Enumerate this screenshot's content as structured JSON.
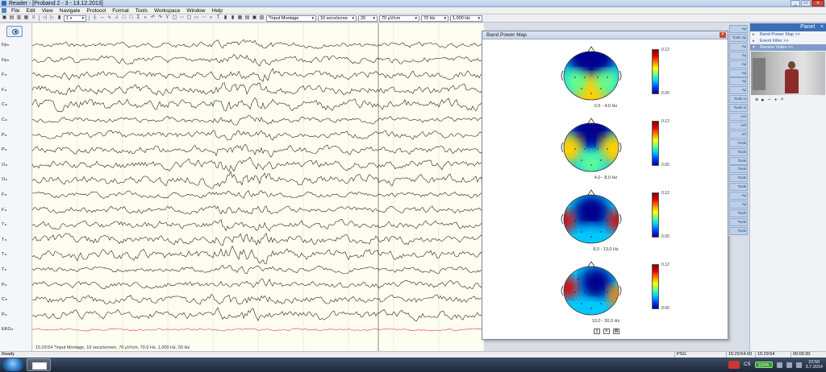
{
  "window": {
    "title": "Reader - [Proband 2 - 3 - 13.12.2013]",
    "controls": [
      "_",
      "▭",
      "x"
    ]
  },
  "menu": [
    "File",
    "Edit",
    "View",
    "Navigate",
    "Protocol",
    "Format",
    "Tools",
    "Workspace",
    "Window",
    "Help"
  ],
  "toolbar": {
    "gain": "1 x",
    "montage": "*Input Montage",
    "timebase": "10 secs/scree",
    "sensitivity_steps": "20",
    "sensitivity": "70 µV/cm",
    "low_filter": "70 Hz",
    "high_filter": "1,000 Hz"
  },
  "channels": [
    "Fp",
    "Fp",
    "F",
    "F",
    "C",
    "C",
    "P",
    "P",
    "O",
    "O",
    "F",
    "F",
    "T",
    "T",
    "T",
    "T",
    "P",
    "C",
    "P",
    "EKG"
  ],
  "eeg": {
    "status_line": "15:29:54 *Input Montage, 10 secs/screen, 70 µV/cm, 70.0 Hz, 1,000 Hz, 50 Hz",
    "trace_color": "#111111",
    "ekg_color": "#d23a3a"
  },
  "band_power_map": {
    "title": "Band Power Map",
    "maps": [
      {
        "band": "0,5 - 4,0 Hz",
        "max": "0.12",
        "min": "0.00"
      },
      {
        "band": "4,0 - 8,0 Hz",
        "max": "0.12",
        "min": "0.00"
      },
      {
        "band": "8,0 - 13,0 Hz",
        "max": "0.12",
        "min": "0.00"
      },
      {
        "band": "13,0 - 30,0 Hz",
        "max": "0.12",
        "min": "0.00"
      }
    ]
  },
  "side_strip": [
    "Ap",
    "Tools Ap",
    "Ap",
    "Ap",
    "Ap",
    "Ap",
    "Ap",
    "Ap",
    "Tools O",
    "Tools O",
    "Arti",
    "Arti",
    "Art",
    "Tools",
    "Tools",
    "Tools",
    "Tools",
    "Tools",
    "Tools",
    "Ap",
    "Ap",
    "Tools",
    "Tools",
    "Tools"
  ],
  "panel": {
    "title": "Panel",
    "links": [
      "Band Power Map >>",
      "Event Filter >>"
    ],
    "review_video": "Review Video <<"
  },
  "status": {
    "ready": "Ready",
    "mode": "PSG",
    "time1": "15:29:54.00",
    "time2": "15:29:54",
    "duration": "00:05:30"
  },
  "taskbar": {
    "language": "CS",
    "battery": "100%",
    "time": "22:50",
    "date": "3.7.2014"
  }
}
